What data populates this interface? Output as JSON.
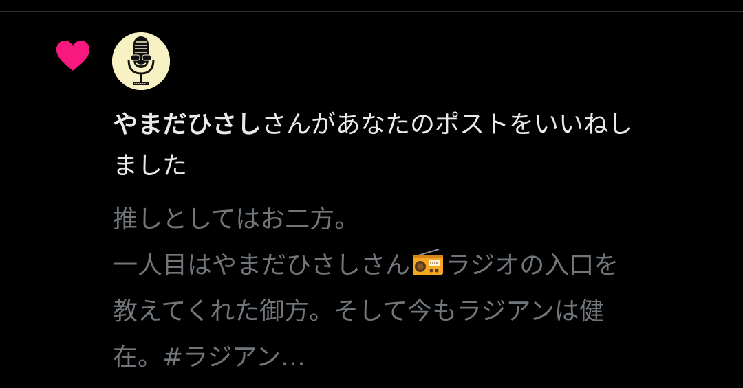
{
  "notification": {
    "type_icon": "heart-icon",
    "user": {
      "name": "やまだひさし",
      "avatar": "microphone-avatar"
    },
    "action_text_line1": "さんがあなたのポストをいいねし",
    "action_text_line2": "ました",
    "post": {
      "line1": "推しとしてはお二方。",
      "line2_before_icon": "一人目はやまだひさしさん",
      "line2_icon": "radio-icon",
      "line2_after_icon": "ラジオの入口を",
      "line3": "教えてくれた御方。そして今もラジアンは健",
      "line4": "在。#ラジアン…"
    }
  },
  "colors": {
    "background": "#000000",
    "heart": "#f91880",
    "primary_text": "#e7e9ea",
    "secondary_text": "#71767b",
    "divider": "#2f3336",
    "avatar_background": "#f7f1c4"
  }
}
